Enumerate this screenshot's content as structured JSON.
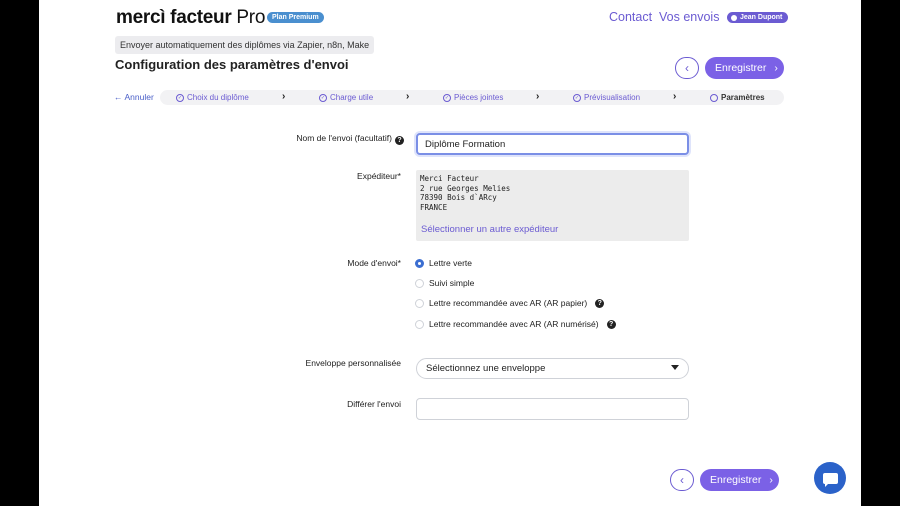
{
  "header": {
    "logo_main": "mercì facteur",
    "logo_suffix": " Pro",
    "plan_badge": "Plan Premium",
    "nav_contact": "Contact",
    "nav_sends": "Vos envois",
    "user_name": "Jean Dupont"
  },
  "page": {
    "tagline": "Envoyer automatiquement des diplômes via Zapier, n8n, Make",
    "title": "Configuration des paramètres d'envoi",
    "save_label": "Enregistrer",
    "back_icon": "chevron-left-icon",
    "save_icon": "chevron-right-icon"
  },
  "stepper": {
    "cancel_label": "Annuler",
    "steps": [
      {
        "label": "Choix du diplôme",
        "state": "done"
      },
      {
        "label": "Charge utile",
        "state": "done"
      },
      {
        "label": "Pièces jointes",
        "state": "done"
      },
      {
        "label": "Prévisualisation",
        "state": "done"
      },
      {
        "label": "Paramètres",
        "state": "current"
      }
    ]
  },
  "form": {
    "name_label": "Nom de l'envoi (facultatif)",
    "name_value": "Diplôme Formation",
    "sender_label": "Expéditeur*",
    "sender_lines": [
      "Merci Facteur",
      "2 rue Georges Melies",
      "78390 Bois d`ARcy",
      "FRANCE"
    ],
    "sender_change": "Sélectionner un autre expéditeur",
    "mode_label": "Mode d'envoi*",
    "mode_options": [
      {
        "label": "Lettre verte",
        "selected": true
      },
      {
        "label": "Suivi simple",
        "selected": false
      },
      {
        "label": "Lettre recommandée avec AR (AR papier)",
        "selected": false
      },
      {
        "label": "Lettre recommandée avec AR (AR numérisé)",
        "selected": false
      }
    ],
    "envelope_label": "Enveloppe personnalisée",
    "envelope_value": "Sélectionnez une enveloppe",
    "delay_label": "Différer l'envoi",
    "delay_value": ""
  },
  "colors": {
    "accent": "#7b61e6",
    "link": "#6b5bd2",
    "badge": "#4a8fcf",
    "chat": "#2b62c9"
  }
}
